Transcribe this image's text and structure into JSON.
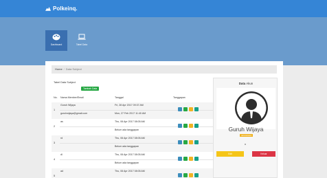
{
  "app": {
    "title": "Polkeinq."
  },
  "nav": [
    {
      "label": "Dashboard",
      "active": true,
      "icon": "palette-icon"
    },
    {
      "label": "Tabel Data",
      "active": false,
      "icon": "laptop-icon"
    }
  ],
  "breadcrumb": {
    "home": "Home",
    "separator": "/",
    "current": "Data Subject"
  },
  "table": {
    "title": "Tabel Data Subject",
    "add_label": "Tambah Data",
    "headers": {
      "no": "No.",
      "name": "Nama Member/Email",
      "date": "Tanggal",
      "response": "Tanggapan"
    },
    "rows": [
      {
        "no": "1",
        "name": "Guruh Wijaya",
        "email": "guruhwijaya@gmail.com",
        "date": "Fri, 28 Apr 2017 09:37 AM",
        "response": "Mon, 27 Feb 2017 11:40 AM"
      },
      {
        "no": "2",
        "name": "as",
        "email": "",
        "date": "Thu, 06 Apr 2017 08:05 AM",
        "response": "Belum ada tanggapan"
      },
      {
        "no": "3",
        "name": "rd",
        "email": "",
        "date": "Thu, 06 Apr 2017 08:05 AM",
        "response": "Belum ada tanggapan"
      },
      {
        "no": "4",
        "name": "dl",
        "email": "",
        "date": "Thu, 06 Apr 2017 08:05 AM",
        "response": "Belum ada tanggapan"
      },
      {
        "no": "5",
        "name": "ad",
        "email": "",
        "date": "Thu, 06 Apr 2017 08:05 AM",
        "response": ""
      }
    ],
    "action_icons": [
      "view-icon",
      "edit-icon",
      "mail-icon",
      "delete-icon"
    ]
  },
  "profile": {
    "title_bold": "Data",
    "title_rest": " Akun",
    "name": "Guruh Wijaya",
    "role": "Administrator",
    "edit_label": "Edit",
    "logout_label": "Keluar"
  },
  "colors": {
    "topbar": "#3585d6",
    "hero": "#6a9bcc",
    "nav_active": "#3a6fb0",
    "add_button": "#27a844",
    "edit_button": "#f5c518",
    "logout_button": "#dc3545"
  }
}
